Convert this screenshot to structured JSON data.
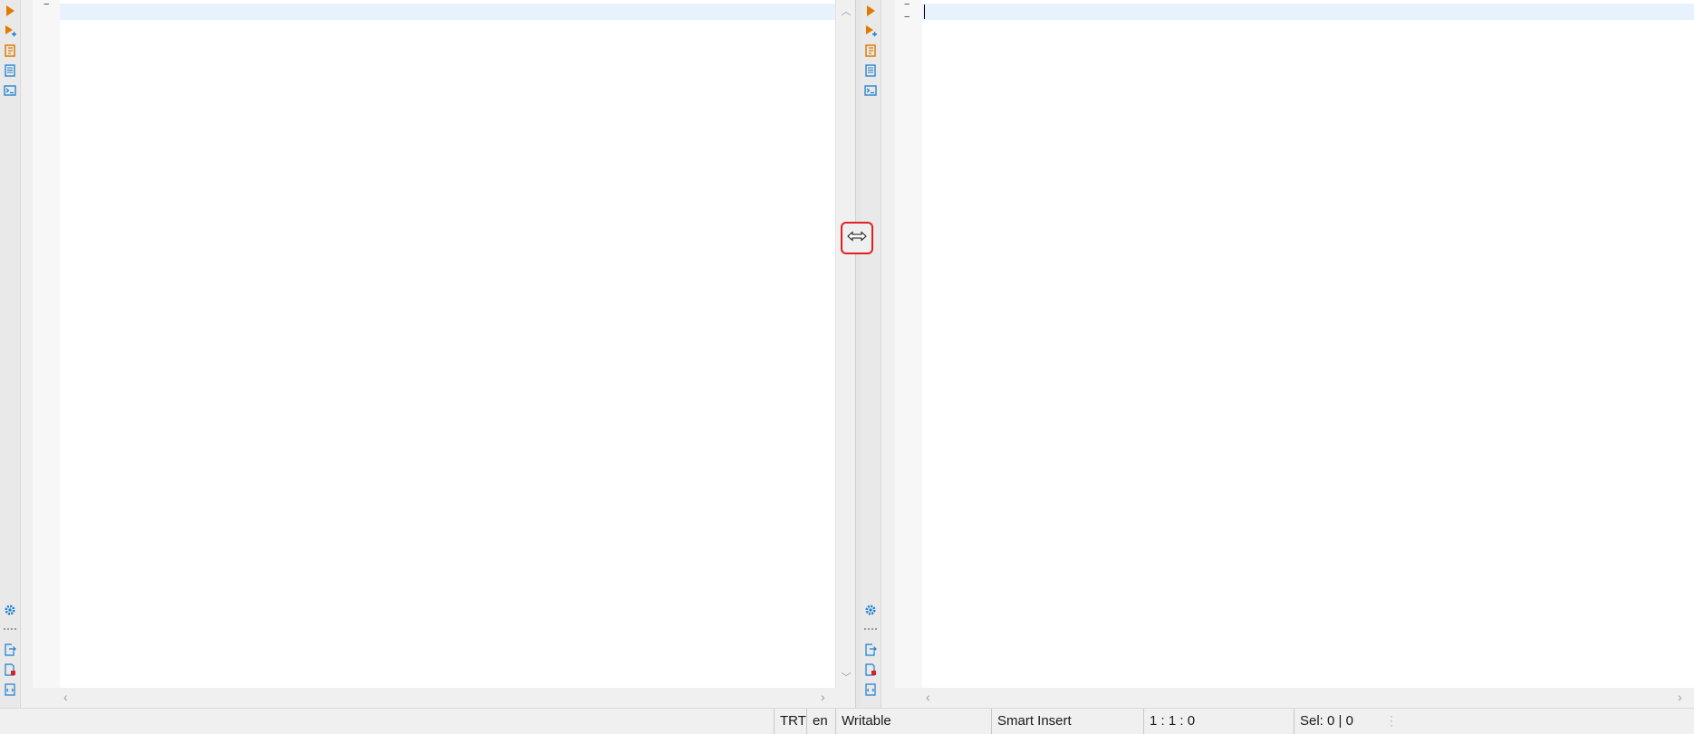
{
  "colors": {
    "accent_orange": "#e07b00",
    "accent_blue": "#1a7fd1",
    "current_line": "#e8f2fe",
    "splitter_highlight": "#e02020"
  },
  "panes": {
    "left": {
      "toolbar_icons": [
        "run-icon",
        "run-with-options-icon",
        "script-file-icon",
        "document-icon",
        "terminal-icon",
        "settings-gear-icon",
        "export-icon",
        "file-error-icon",
        "xml-file-icon"
      ],
      "fold_marker": "−"
    },
    "right": {
      "toolbar_icons": [
        "run-icon",
        "run-with-options-icon",
        "script-file-icon",
        "document-icon",
        "terminal-icon",
        "settings-gear-icon",
        "export-icon",
        "file-error-icon",
        "xml-file-icon"
      ],
      "fold_marker_1": "−",
      "fold_marker_2": "−"
    }
  },
  "splitter": {
    "icon": "resize-horizontal-icon"
  },
  "statusbar": {
    "encoding": "TRT",
    "language": "en",
    "mode": "Writable",
    "insert_mode": "Smart Insert",
    "position": "1 : 1 : 0",
    "selection": "Sel: 0 | 0"
  }
}
